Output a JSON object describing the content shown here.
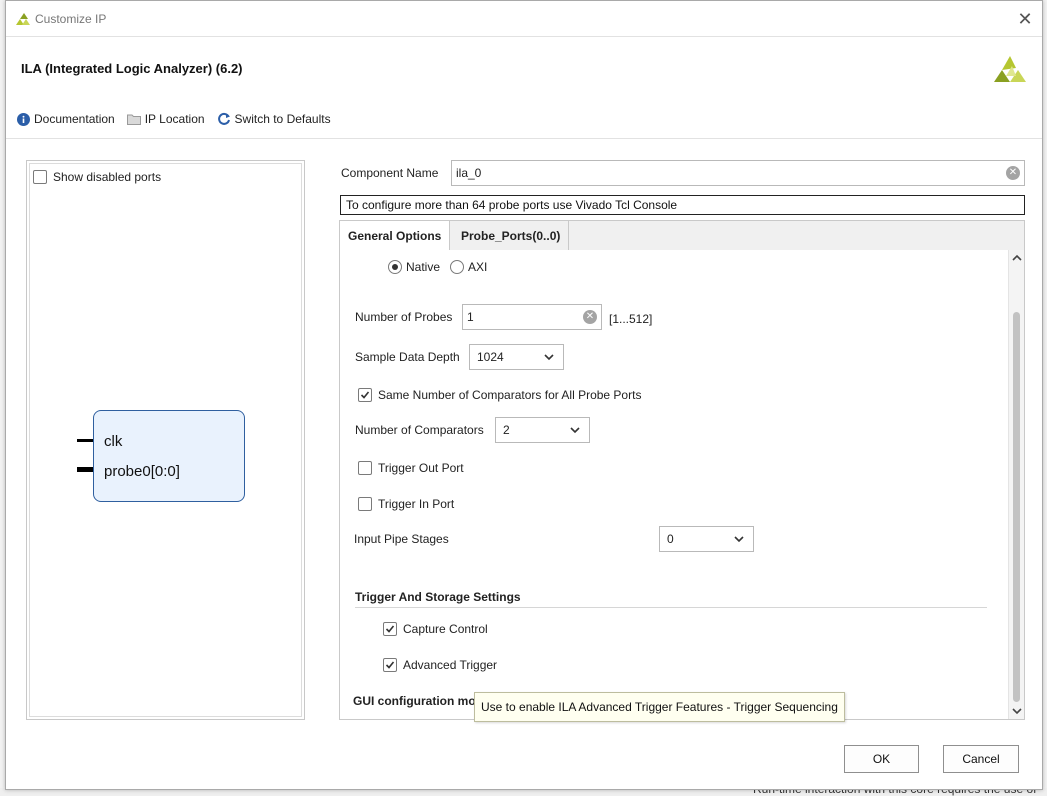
{
  "window": {
    "title": "Customize IP"
  },
  "header": {
    "ip_title": "ILA (Integrated Logic Analyzer) (6.2)"
  },
  "toolbar": {
    "documentation": "Documentation",
    "ip_location": "IP Location",
    "switch_defaults": "Switch to Defaults"
  },
  "left_panel": {
    "show_disabled_ports": "Show disabled ports",
    "show_disabled_checked": false,
    "ports": [
      "clk",
      "probe0[0:0]"
    ]
  },
  "component": {
    "label": "Component Name",
    "value": "ila_0"
  },
  "notice": "To configure more than 64 probe ports use Vivado Tcl Console",
  "tabs": [
    "General Options",
    "Probe_Ports(0..0)"
  ],
  "general": {
    "interface_options": [
      "Native",
      "AXI"
    ],
    "interface_selected": "Native",
    "num_probes_label": "Number of Probes",
    "num_probes_value": "1",
    "num_probes_range": "[1...512]",
    "sample_depth_label": "Sample Data Depth",
    "sample_depth_value": "1024",
    "same_comparators_label": "Same Number of Comparators for All Probe Ports",
    "same_comparators_checked": true,
    "num_comparators_label": "Number of Comparators",
    "num_comparators_value": "2",
    "trigger_out_label": "Trigger Out Port",
    "trigger_out_checked": false,
    "trigger_in_label": "Trigger In Port",
    "trigger_in_checked": false,
    "pipe_stages_label": "Input Pipe Stages",
    "pipe_stages_value": "0",
    "trigger_section_title": "Trigger And Storage Settings",
    "capture_control_label": "Capture Control",
    "capture_control_checked": true,
    "advanced_trigger_label": "Advanced Trigger",
    "advanced_trigger_checked": true,
    "gui_config_label": "GUI configuration mod"
  },
  "tooltip": "Use to enable ILA Advanced Trigger Features - Trigger Sequencing",
  "buttons": {
    "ok": "OK",
    "cancel": "Cancel"
  },
  "background": {
    "bottom_text": "Run-time interaction with this core requires the use of"
  },
  "colors": {
    "xilinx_logo": "#b5c630",
    "info_icon": "#2b5ea8",
    "symbol_fill": "#e9f2fd",
    "symbol_border": "#2f5f9f",
    "tooltip_bg": "#fffff0"
  }
}
